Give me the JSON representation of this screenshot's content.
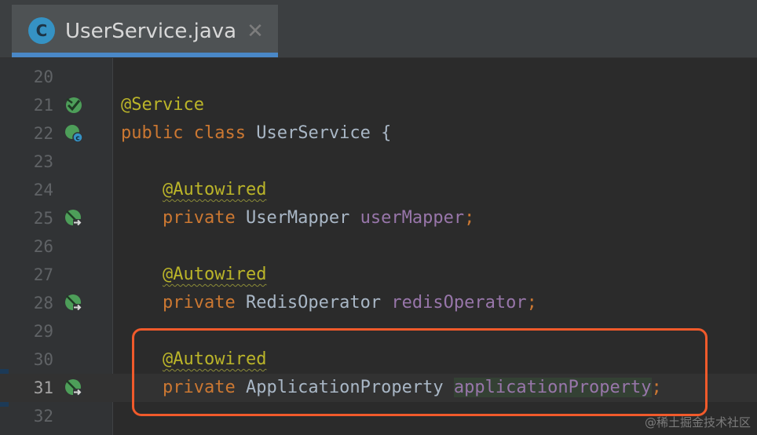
{
  "tab": {
    "icon_letter": "C",
    "title": "UserService.java",
    "close_glyph": "✕"
  },
  "gutter_icons": {
    "21": "bean-implemented-icon",
    "22": "bean-class-icon",
    "25": "autowired-navigate-icon",
    "28": "autowired-navigate-icon",
    "31": "autowired-navigate-icon"
  },
  "lines": [
    {
      "n": "20",
      "ann": "",
      "kw1": "",
      "kw2": "",
      "type": "",
      "field": "",
      "punct": ""
    },
    {
      "n": "21",
      "ann": "@Service"
    },
    {
      "n": "22",
      "kw1": "public",
      "kw2": "class",
      "type": "UserService",
      "punct": "{"
    },
    {
      "n": "23"
    },
    {
      "n": "24",
      "ann": "@Autowired"
    },
    {
      "n": "25",
      "kw1": "private",
      "type": "UserMapper",
      "field": "userMapper",
      "punct": ";"
    },
    {
      "n": "26"
    },
    {
      "n": "27",
      "ann": "@Autowired"
    },
    {
      "n": "28",
      "kw1": "private",
      "type": "RedisOperator",
      "field": "redisOperator",
      "punct": ";"
    },
    {
      "n": "29"
    },
    {
      "n": "30",
      "ann": "@Autowired"
    },
    {
      "n": "31",
      "kw1": "private",
      "type": "ApplicationProperty",
      "field": "applicationProperty",
      "punct": ";"
    },
    {
      "n": "32"
    }
  ],
  "colors": {
    "annotation": "#bbb529",
    "keyword": "#cc7832",
    "field": "#9876aa",
    "highlight_box": "#f15a2b",
    "tab_underline": "#4a88c7"
  },
  "watermark": "@稀土掘金技术社区"
}
